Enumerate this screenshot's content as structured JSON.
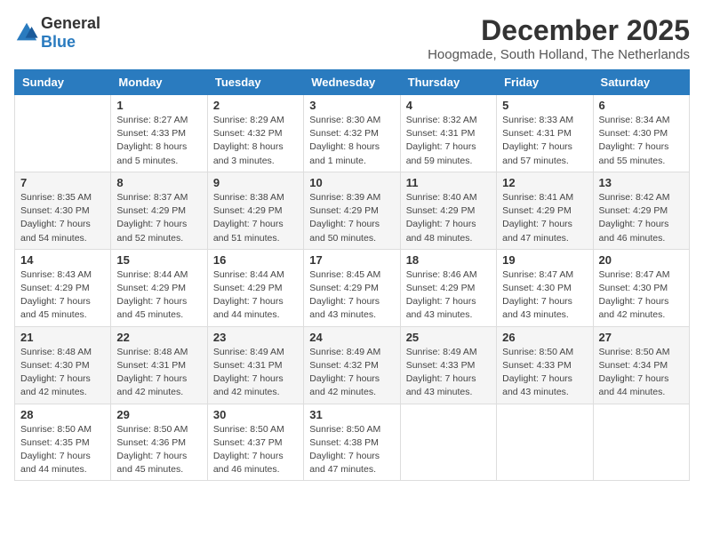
{
  "header": {
    "logo_general": "General",
    "logo_blue": "Blue",
    "month": "December 2025",
    "location": "Hoogmade, South Holland, The Netherlands"
  },
  "days_of_week": [
    "Sunday",
    "Monday",
    "Tuesday",
    "Wednesday",
    "Thursday",
    "Friday",
    "Saturday"
  ],
  "weeks": [
    [
      {
        "day": "",
        "sunrise": "",
        "sunset": "",
        "daylight": ""
      },
      {
        "day": "1",
        "sunrise": "Sunrise: 8:27 AM",
        "sunset": "Sunset: 4:33 PM",
        "daylight": "Daylight: 8 hours and 5 minutes."
      },
      {
        "day": "2",
        "sunrise": "Sunrise: 8:29 AM",
        "sunset": "Sunset: 4:32 PM",
        "daylight": "Daylight: 8 hours and 3 minutes."
      },
      {
        "day": "3",
        "sunrise": "Sunrise: 8:30 AM",
        "sunset": "Sunset: 4:32 PM",
        "daylight": "Daylight: 8 hours and 1 minute."
      },
      {
        "day": "4",
        "sunrise": "Sunrise: 8:32 AM",
        "sunset": "Sunset: 4:31 PM",
        "daylight": "Daylight: 7 hours and 59 minutes."
      },
      {
        "day": "5",
        "sunrise": "Sunrise: 8:33 AM",
        "sunset": "Sunset: 4:31 PM",
        "daylight": "Daylight: 7 hours and 57 minutes."
      },
      {
        "day": "6",
        "sunrise": "Sunrise: 8:34 AM",
        "sunset": "Sunset: 4:30 PM",
        "daylight": "Daylight: 7 hours and 55 minutes."
      }
    ],
    [
      {
        "day": "7",
        "sunrise": "Sunrise: 8:35 AM",
        "sunset": "Sunset: 4:30 PM",
        "daylight": "Daylight: 7 hours and 54 minutes."
      },
      {
        "day": "8",
        "sunrise": "Sunrise: 8:37 AM",
        "sunset": "Sunset: 4:29 PM",
        "daylight": "Daylight: 7 hours and 52 minutes."
      },
      {
        "day": "9",
        "sunrise": "Sunrise: 8:38 AM",
        "sunset": "Sunset: 4:29 PM",
        "daylight": "Daylight: 7 hours and 51 minutes."
      },
      {
        "day": "10",
        "sunrise": "Sunrise: 8:39 AM",
        "sunset": "Sunset: 4:29 PM",
        "daylight": "Daylight: 7 hours and 50 minutes."
      },
      {
        "day": "11",
        "sunrise": "Sunrise: 8:40 AM",
        "sunset": "Sunset: 4:29 PM",
        "daylight": "Daylight: 7 hours and 48 minutes."
      },
      {
        "day": "12",
        "sunrise": "Sunrise: 8:41 AM",
        "sunset": "Sunset: 4:29 PM",
        "daylight": "Daylight: 7 hours and 47 minutes."
      },
      {
        "day": "13",
        "sunrise": "Sunrise: 8:42 AM",
        "sunset": "Sunset: 4:29 PM",
        "daylight": "Daylight: 7 hours and 46 minutes."
      }
    ],
    [
      {
        "day": "14",
        "sunrise": "Sunrise: 8:43 AM",
        "sunset": "Sunset: 4:29 PM",
        "daylight": "Daylight: 7 hours and 45 minutes."
      },
      {
        "day": "15",
        "sunrise": "Sunrise: 8:44 AM",
        "sunset": "Sunset: 4:29 PM",
        "daylight": "Daylight: 7 hours and 45 minutes."
      },
      {
        "day": "16",
        "sunrise": "Sunrise: 8:44 AM",
        "sunset": "Sunset: 4:29 PM",
        "daylight": "Daylight: 7 hours and 44 minutes."
      },
      {
        "day": "17",
        "sunrise": "Sunrise: 8:45 AM",
        "sunset": "Sunset: 4:29 PM",
        "daylight": "Daylight: 7 hours and 43 minutes."
      },
      {
        "day": "18",
        "sunrise": "Sunrise: 8:46 AM",
        "sunset": "Sunset: 4:29 PM",
        "daylight": "Daylight: 7 hours and 43 minutes."
      },
      {
        "day": "19",
        "sunrise": "Sunrise: 8:47 AM",
        "sunset": "Sunset: 4:30 PM",
        "daylight": "Daylight: 7 hours and 43 minutes."
      },
      {
        "day": "20",
        "sunrise": "Sunrise: 8:47 AM",
        "sunset": "Sunset: 4:30 PM",
        "daylight": "Daylight: 7 hours and 42 minutes."
      }
    ],
    [
      {
        "day": "21",
        "sunrise": "Sunrise: 8:48 AM",
        "sunset": "Sunset: 4:30 PM",
        "daylight": "Daylight: 7 hours and 42 minutes."
      },
      {
        "day": "22",
        "sunrise": "Sunrise: 8:48 AM",
        "sunset": "Sunset: 4:31 PM",
        "daylight": "Daylight: 7 hours and 42 minutes."
      },
      {
        "day": "23",
        "sunrise": "Sunrise: 8:49 AM",
        "sunset": "Sunset: 4:31 PM",
        "daylight": "Daylight: 7 hours and 42 minutes."
      },
      {
        "day": "24",
        "sunrise": "Sunrise: 8:49 AM",
        "sunset": "Sunset: 4:32 PM",
        "daylight": "Daylight: 7 hours and 42 minutes."
      },
      {
        "day": "25",
        "sunrise": "Sunrise: 8:49 AM",
        "sunset": "Sunset: 4:33 PM",
        "daylight": "Daylight: 7 hours and 43 minutes."
      },
      {
        "day": "26",
        "sunrise": "Sunrise: 8:50 AM",
        "sunset": "Sunset: 4:33 PM",
        "daylight": "Daylight: 7 hours and 43 minutes."
      },
      {
        "day": "27",
        "sunrise": "Sunrise: 8:50 AM",
        "sunset": "Sunset: 4:34 PM",
        "daylight": "Daylight: 7 hours and 44 minutes."
      }
    ],
    [
      {
        "day": "28",
        "sunrise": "Sunrise: 8:50 AM",
        "sunset": "Sunset: 4:35 PM",
        "daylight": "Daylight: 7 hours and 44 minutes."
      },
      {
        "day": "29",
        "sunrise": "Sunrise: 8:50 AM",
        "sunset": "Sunset: 4:36 PM",
        "daylight": "Daylight: 7 hours and 45 minutes."
      },
      {
        "day": "30",
        "sunrise": "Sunrise: 8:50 AM",
        "sunset": "Sunset: 4:37 PM",
        "daylight": "Daylight: 7 hours and 46 minutes."
      },
      {
        "day": "31",
        "sunrise": "Sunrise: 8:50 AM",
        "sunset": "Sunset: 4:38 PM",
        "daylight": "Daylight: 7 hours and 47 minutes."
      },
      {
        "day": "",
        "sunrise": "",
        "sunset": "",
        "daylight": ""
      },
      {
        "day": "",
        "sunrise": "",
        "sunset": "",
        "daylight": ""
      },
      {
        "day": "",
        "sunrise": "",
        "sunset": "",
        "daylight": ""
      }
    ]
  ]
}
